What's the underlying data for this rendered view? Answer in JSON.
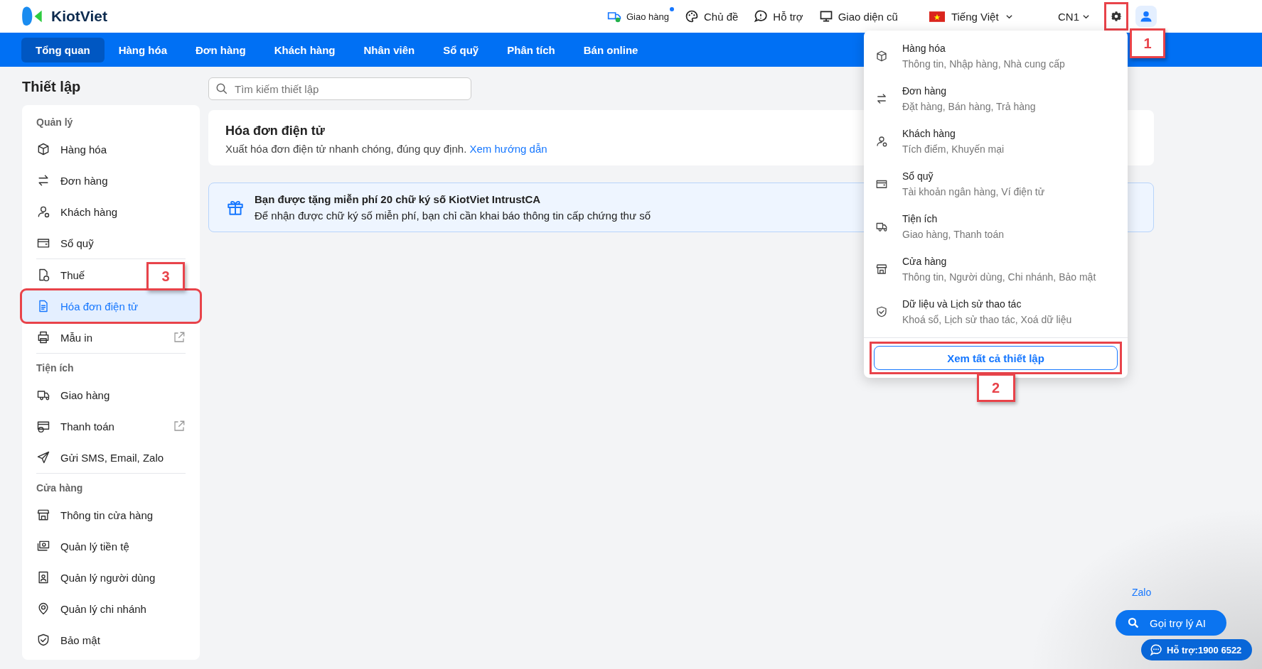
{
  "header": {
    "logo": "KiotViet",
    "links": [
      {
        "label": "Giao hàng",
        "dot": true
      },
      {
        "label": "Chủ đề",
        "dot": false
      },
      {
        "label": "Hỗ trợ",
        "dot": false
      },
      {
        "label": "Giao diện cũ",
        "dot": false
      }
    ],
    "language": "Tiếng Việt",
    "branch": "CN1",
    "settings_callout": "1"
  },
  "nav": [
    {
      "label": "Tổng quan",
      "selected": true
    },
    {
      "label": "Hàng hóa",
      "selected": false
    },
    {
      "label": "Đơn hàng",
      "selected": false
    },
    {
      "label": "Khách hàng",
      "selected": false
    },
    {
      "label": "Nhân viên",
      "selected": false
    },
    {
      "label": "Sổ quỹ",
      "selected": false
    },
    {
      "label": "Phân tích",
      "selected": false
    },
    {
      "label": "Bán online",
      "selected": false
    }
  ],
  "sidebar": {
    "title": "Thiết lập",
    "sections": [
      {
        "title": "Quản lý",
        "groups": [
          {
            "items": [
              {
                "label": "Hàng hóa",
                "selected": false,
                "external": false
              },
              {
                "label": "Đơn hàng",
                "selected": false,
                "external": false
              },
              {
                "label": "Khách hàng",
                "selected": false,
                "external": false
              },
              {
                "label": "Sổ quỹ",
                "selected": false,
                "external": false
              }
            ]
          },
          {
            "items": [
              {
                "label": "Thuế",
                "selected": false,
                "external": false
              },
              {
                "label": "Hóa đơn điện tử",
                "selected": true,
                "external": false,
                "callout": "3"
              },
              {
                "label": "Mẫu in",
                "selected": false,
                "external": true
              }
            ]
          }
        ]
      },
      {
        "title": "Tiện ích",
        "groups": [
          {
            "items": [
              {
                "label": "Giao hàng",
                "selected": false,
                "external": false
              },
              {
                "label": "Thanh toán",
                "selected": false,
                "external": true
              },
              {
                "label": "Gửi SMS, Email, Zalo",
                "selected": false,
                "external": false
              }
            ]
          }
        ]
      },
      {
        "title": "Cửa hàng",
        "groups": [
          {
            "items": [
              {
                "label": "Thông tin cửa hàng",
                "selected": false,
                "external": false
              },
              {
                "label": "Quản lý tiền tệ",
                "selected": false,
                "external": false
              },
              {
                "label": "Quản lý người dùng",
                "selected": false,
                "external": false
              },
              {
                "label": "Quản lý chi nhánh",
                "selected": false,
                "external": false
              },
              {
                "label": "Bảo mật",
                "selected": false,
                "external": false
              }
            ]
          }
        ]
      }
    ]
  },
  "search": {
    "placeholder": "Tìm kiếm thiết lập"
  },
  "page": {
    "title": "Hóa đơn điện tử",
    "description": "Xuất hóa đơn điện tử nhanh chóng, đúng quy định.",
    "link": "Xem hướng dẫn"
  },
  "banner": {
    "title": "Bạn được tặng miễn phí 20 chữ ký số KiotViet IntrustCA",
    "text": "Để nhận được chữ ký số miễn phí, bạn chỉ cần khai báo thông tin cấp chứng thư số"
  },
  "settings_menu": {
    "items": [
      {
        "title": "Hàng hóa",
        "subtitle": "Thông tin, Nhập hàng, Nhà cung cấp"
      },
      {
        "title": "Đơn hàng",
        "subtitle": "Đặt hàng, Bán hàng, Trả hàng"
      },
      {
        "title": "Khách hàng",
        "subtitle": "Tích điểm, Khuyến mại"
      },
      {
        "title": "Sổ quỹ",
        "subtitle": "Tài khoản ngân hàng, Ví điện tử"
      },
      {
        "title": "Tiện ích",
        "subtitle": "Giao hàng, Thanh toán"
      },
      {
        "title": "Cửa hàng",
        "subtitle": "Thông tin, Người dùng, Chi nhánh, Bảo mật"
      },
      {
        "title": "Dữ liệu và Lịch sử thao tác",
        "subtitle": "Khoá sổ, Lịch sử thao tác, Xoá dữ liệu"
      }
    ],
    "footer_button": "Xem tất cả thiết lập",
    "footer_callout": "2"
  },
  "floating": {
    "zalo": "Zalo",
    "ai_button": "Gọi trợ lý AI",
    "support_button": "Hỗ trợ:1900 6522"
  }
}
